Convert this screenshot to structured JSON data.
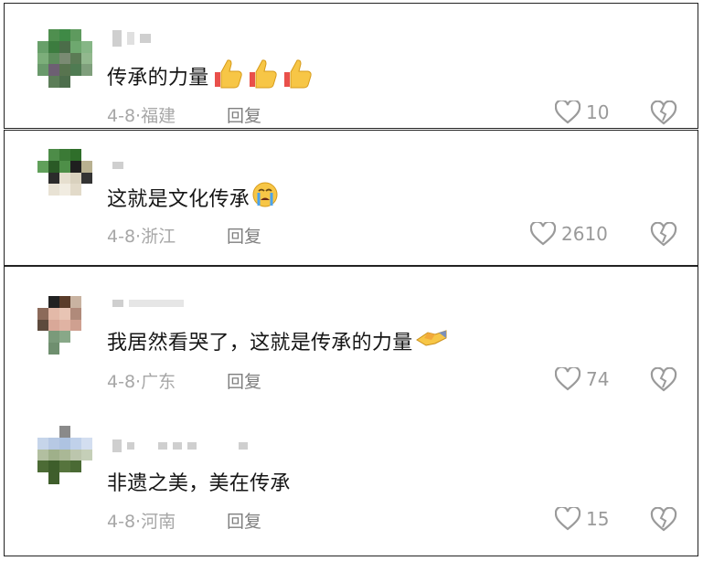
{
  "comments": [
    {
      "text": "传承的力量",
      "emoji": "thumbs-up-icon x3",
      "date": "4-8",
      "location": "福建",
      "reply": "回复",
      "likes": "10"
    },
    {
      "text": "这就是文化传承",
      "emoji": "loudly-crying-face-icon",
      "date": "4-8",
      "location": "浙江",
      "reply": "回复",
      "likes": "2610"
    },
    {
      "text": "我居然看哭了，这就是传承的力量",
      "emoji": "handshake-icon",
      "date": "4-8",
      "location": "广东",
      "reply": "回复",
      "likes": "74"
    },
    {
      "text": "非遗之美，美在传承",
      "emoji": "",
      "date": "4-8",
      "location": "河南",
      "reply": "回复",
      "likes": "15"
    }
  ],
  "meta_separator": "·"
}
